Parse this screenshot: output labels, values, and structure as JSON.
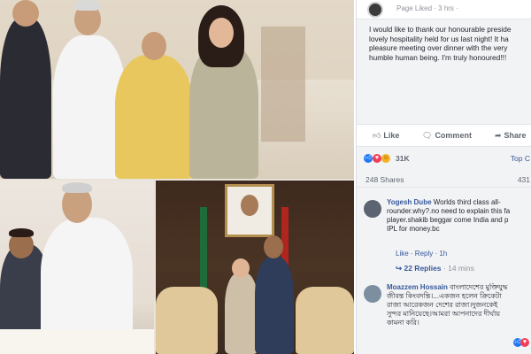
{
  "post": {
    "meta": "Page Liked · 3 hrs ·",
    "text_lines": [
      "I would like to thank our honourable preside",
      "lovely hospitality held for us last night! It ha",
      "pleasure meeting over dinner with the very",
      "humble human being. I'm truly honoured!!!"
    ]
  },
  "actions": {
    "like": "Like",
    "comment": "Comment",
    "share": "Share"
  },
  "stats": {
    "reaction_count": "31K",
    "top_comments": "Top C",
    "shares": "248 Shares",
    "views": "431"
  },
  "comments": [
    {
      "author": "Yogesh Dube",
      "lines": [
        " Worlds third class all-",
        "rounder.why?.no need to explain this fa",
        "player.shakib beggar come India and p",
        "IPL for money.bc"
      ],
      "links": "Like · Reply · 1h",
      "replies": "22 Replies",
      "replies_time": "· 14 mins"
    },
    {
      "author": "Moazzem Hossain",
      "lines": [
        " বাংলাদেশের মুক্তিযুদ্ধ",
        "জীবন্ত কিংবদন্তি।...একজন হলেন ক্রিকেটা",
        "রাজা আরেকজন দেশের রাজা।দুজনকেই",
        "সুন্দর মানিয়েছে।আমরা আপনাদের দীর্ঘায়",
        "কামনা করি।"
      ]
    }
  ],
  "icons": {
    "like": "thumbs-up-icon",
    "comment": "comment-bubble-icon",
    "share": "share-arrow-icon"
  },
  "colors": {
    "facebook_blue": "#365899",
    "like_blue": "#2078f4",
    "love_red": "#f33e58",
    "haha_yellow": "#f7b125"
  }
}
